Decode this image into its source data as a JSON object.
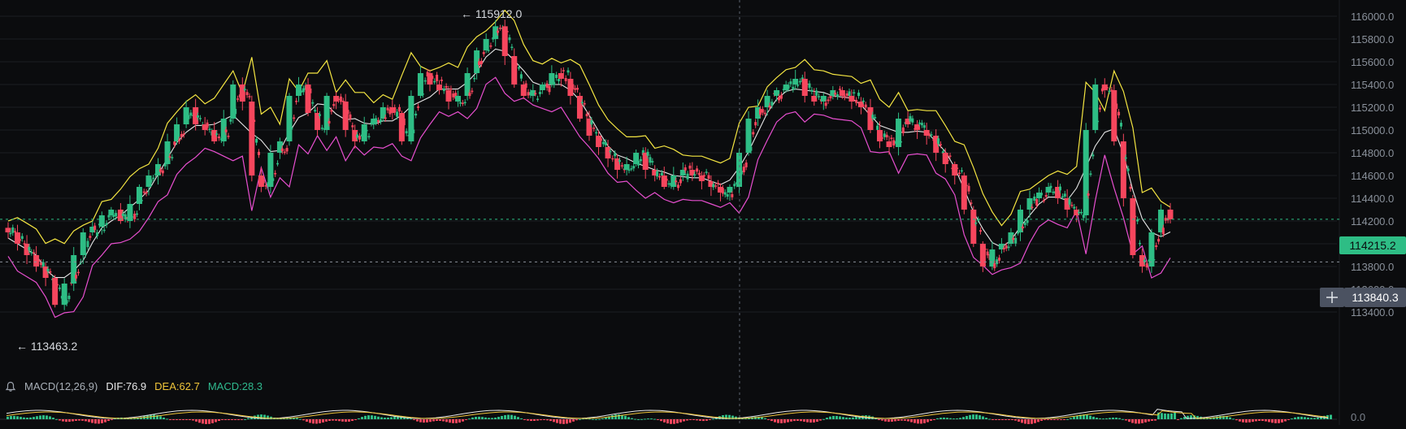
{
  "colors": {
    "background": "#0b0c0e",
    "grid": "#1b1e23",
    "up": "#2ebd85",
    "down": "#f6465d",
    "upper_band": "#f5e642",
    "middle_band": "#e6e6e6",
    "lower_band": "#e84fd0",
    "last_price_label": "#2ebd85",
    "crosshair_label": "#4b5261",
    "dif_line": "#e8e8e8",
    "dea_line": "#f0c53a",
    "macd_hist": "#2fb98e"
  },
  "price_axis": {
    "ticks": [
      "116000.0",
      "115800.0",
      "115600.0",
      "115400.0",
      "115200.0",
      "115000.0",
      "114800.0",
      "114600.0",
      "114400.0",
      "114200.0",
      "114000.0",
      "113800.0",
      "113600.0",
      "113400.0"
    ]
  },
  "markers": {
    "high_label": "← 115912.0",
    "low_label": "← 113463.2"
  },
  "last_price": {
    "label": "114215.2",
    "value": 114215.2
  },
  "crosshair": {
    "label": "113840.3",
    "value": 113840.3,
    "plus_icon": "plus-icon"
  },
  "macd_legend": {
    "title": "MACD(12,26,9)",
    "dif": "DIF:76.9",
    "dea": "DEA:62.7",
    "macd": "MACD:28.3"
  },
  "macd_axis": {
    "zero_label": "0.0"
  },
  "chart_data": {
    "type": "line",
    "title": "",
    "ylim": [
      113400,
      116000
    ],
    "series": [
      {
        "name": "",
        "values": [
          114100,
          114000,
          113900,
          113800,
          113700,
          113463,
          113650,
          113900,
          114100,
          114150,
          114250,
          114300,
          114200,
          114350,
          114500,
          114600,
          114700,
          114900,
          115050,
          115200,
          115050,
          115000,
          114900,
          115100,
          115400,
          115250,
          114600,
          114500,
          114800,
          114900,
          115300,
          115400,
          115150,
          115000,
          115300,
          115250,
          115000,
          114900,
          115050,
          115100,
          115200,
          115150,
          114900,
          115300,
          115500,
          115400,
          115350,
          115250,
          115300,
          115500,
          115700,
          115800,
          115912,
          115650,
          115400,
          115300,
          115350,
          115400,
          115500,
          115450,
          115300,
          115100,
          114950,
          114850,
          114750,
          114650,
          114700,
          114800,
          114650,
          114600,
          114500,
          114600,
          114650,
          114600,
          114550,
          114500,
          114450,
          114500,
          114800,
          115100,
          115200,
          115300,
          115350,
          115400,
          115450,
          115300,
          115250,
          115300,
          115350,
          115300,
          115250,
          115200,
          115000,
          114900,
          114850,
          115100,
          115050,
          115000,
          114950,
          114800,
          114700,
          114600,
          114300,
          114000,
          113800,
          113950,
          114000,
          114100,
          114300,
          114400,
          114450,
          114500,
          114400,
          114300,
          114250,
          115000,
          115400,
          115350,
          114900,
          114400,
          113900,
          113800,
          114100,
          114300,
          114215
        ]
      }
    ]
  }
}
